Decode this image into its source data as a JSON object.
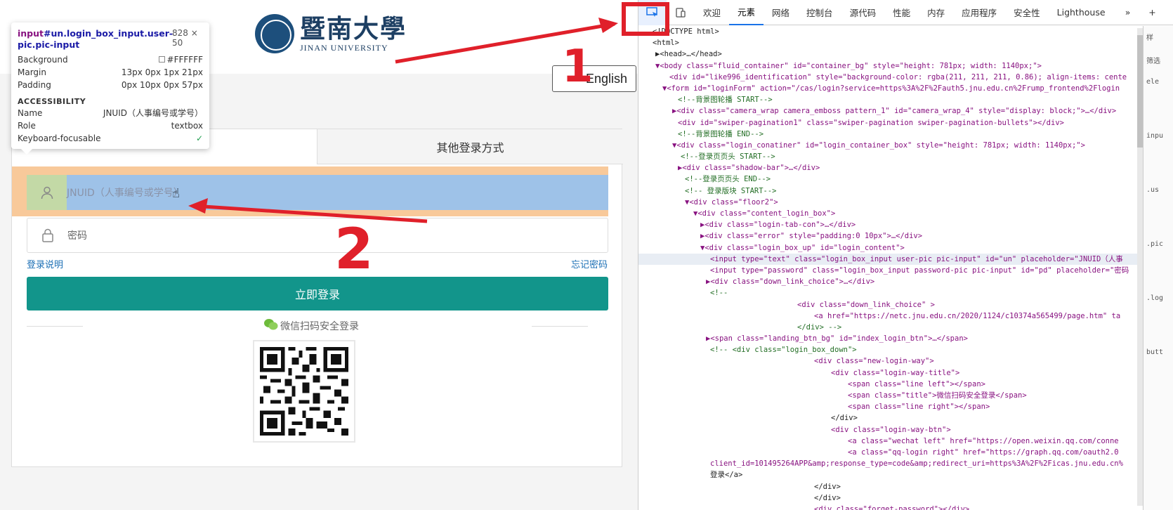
{
  "page": {
    "logo": {
      "cn": "暨南大學",
      "en": "JINAN UNIVERSITY"
    },
    "english_button": "English",
    "tabs": [
      "",
      "其他登录方式"
    ],
    "user_input_placeholder": "JNUID（人事编号或学号）",
    "password_placeholder": "密码",
    "login_help": "登录说明",
    "forgot_password": "忘记密码",
    "login_button": "立即登录",
    "wechat_login": "微信扫码安全登录"
  },
  "inspect_tooltip": {
    "selector_tag": "input",
    "selector_rest": "#un.login_box_input.user-pic.pic-input",
    "size": "828 × 50",
    "rows": [
      {
        "label": "Background",
        "value": "#FFFFFF"
      },
      {
        "label": "Margin",
        "value": "13px 0px 1px 21px"
      },
      {
        "label": "Padding",
        "value": "0px 10px 0px 57px"
      }
    ],
    "accessibility_title": "ACCESSIBILITY",
    "a11y": [
      {
        "label": "Name",
        "value": "JNUID（人事编号或学号）"
      },
      {
        "label": "Role",
        "value": "textbox"
      },
      {
        "label": "Keyboard-focusable",
        "value": "✓"
      }
    ]
  },
  "annotations": [
    "1",
    "2"
  ],
  "devtools": {
    "tabs": [
      "欢迎",
      "元素",
      "网络",
      "控制台",
      "源代码",
      "性能",
      "内存",
      "应用程序",
      "安全性",
      "Lighthouse"
    ],
    "active_tab": "元素",
    "lines": [
      "<!DOCTYPE html>",
      "<html>",
      "▶<head>…</head>",
      "▼<body class=\"fluid_container\" id=\"container_bg\" style=\"height: 781px; width: 1140px;\">",
      "<div id=\"like996_identification\" style=\"background-color: rgba(211, 211, 211, 0.86); align-items: cente",
      "▼<form id=\"loginForm\" action=\"/cas/login?service=https%3A%2F%2Fauth5.jnu.edu.cn%2Frump_frontend%2Flogin",
      "<!--背景图轮播 START-->",
      "▶<div class=\"camera_wrap camera_emboss pattern_1\" id=\"camera_wrap_4\" style=\"display: block;\">…</div>",
      "<div id=\"swiper-pagination1\" class=\"swiper-pagination swiper-pagination-bullets\"></div>",
      "<!--背景图轮播 END-->",
      "▼<div class=\"login_conatiner\" id=\"login_container_box\" style=\"height: 781px; width: 1140px;\">",
      "<!--登录页页头 START-->",
      "▶<div class=\"shadow-bar\">…</div>",
      "<!--登录页页头 END-->",
      "<!-- 登录版块 START-->",
      "▼<div class=\"floor2\">",
      "▼<div class=\"content_login_box\">",
      "▶<div class=\"login-tab-con\">…</div>",
      "▶<div class=\"error\" style=\"padding:0 10px\">…</div>",
      "▼<div class=\"login_box_up\" id=\"login_content\">",
      "<input type=\"text\" class=\"login_box_input user-pic pic-input\" id=\"un\" placeholder=\"JNUID（人事",
      "<input type=\"password\" class=\"login_box_input password-pic pic-input\" id=\"pd\" placeholder=\"密码",
      "▶<div class=\"down_link_choice\">…</div>",
      "<!--",
      "<div class=\"down_link_choice\" >",
      "<a href=\"https://netc.jnu.edu.cn/2020/1124/c10374a565499/page.htm\" ta",
      "</div>   -->",
      "▶<span class=\"landing_btn_bg\" id=\"index_login_btn\">…</span>",
      "<!-- <div class=\"login_box_down\">",
      "<div class=\"new-login-way\">",
      "<div class=\"login-way-title\">",
      "<span class=\"line left\"></span>",
      "<span class=\"title\">微信扫码安全登录</span>",
      "<span class=\"line right\"></span>",
      "</div>",
      "<div class=\"login-way-btn\">",
      "<a class=\"wechat left\"  href=\"https://open.weixin.qq.com/conne",
      "<a class=\"qq-login right\" href=\"https://graph.qq.com/oauth2.0",
      "client_id=101495264APP&amp;response_type=code&amp;redirect_uri=https%3A%2F%2Ficas.jnu.edu.cn%",
      "登录</a>",
      "</div>",
      "</div>",
      "<div class=\"forget-password\"></div>"
    ],
    "side_labels": [
      "样",
      "筛选",
      "ele",
      "inpu",
      ".us",
      ".pic",
      ".log",
      "butt"
    ]
  }
}
